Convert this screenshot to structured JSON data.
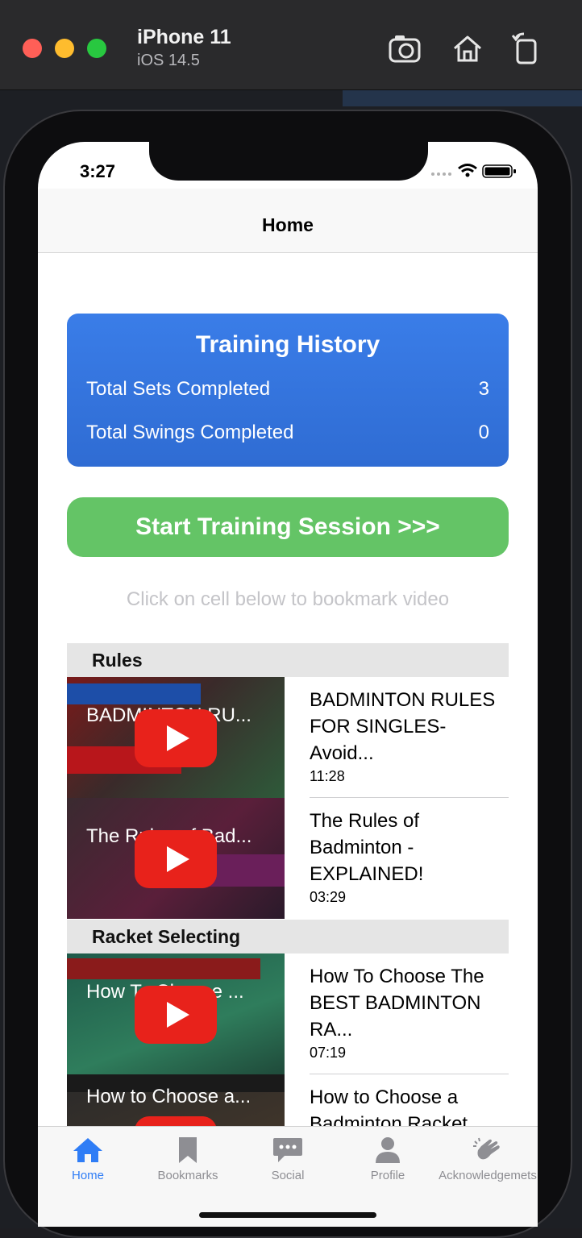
{
  "simulator": {
    "device_name": "iPhone 11",
    "os_version": "iOS 14.5"
  },
  "status_bar": {
    "time": "3:27"
  },
  "nav": {
    "title": "Home"
  },
  "training_history": {
    "title": "Training History",
    "rows": [
      {
        "label": "Total Sets Completed",
        "value": "3"
      },
      {
        "label": "Total Swings Completed",
        "value": "0"
      }
    ]
  },
  "start_button": {
    "label": "Start Training Session >>>"
  },
  "hint": "Click on cell below to bookmark video",
  "sections": [
    {
      "title": "Rules",
      "videos": [
        {
          "title": "BADMINTON RULES FOR SINGLES- Avoid...",
          "duration": "11:28",
          "thumb_text": "BADMINTON RU..."
        },
        {
          "title": "The Rules of Badminton - EXPLAINED!",
          "duration": "03:29",
          "thumb_text": "The Rules of Bad..."
        }
      ]
    },
    {
      "title": "Racket Selecting",
      "videos": [
        {
          "title": "How To Choose The BEST BADMINTON RA...",
          "duration": "07:19",
          "thumb_text": "How To Choose ..."
        },
        {
          "title": "How to Choose a Badminton Racket",
          "duration": "",
          "thumb_text": "How to Choose a..."
        }
      ]
    }
  ],
  "tab_bar": {
    "items": [
      {
        "label": "Home",
        "icon": "house-icon",
        "active": true
      },
      {
        "label": "Bookmarks",
        "icon": "bookmark-icon",
        "active": false
      },
      {
        "label": "Social",
        "icon": "chat-bubble-icon",
        "active": false
      },
      {
        "label": "Profile",
        "icon": "person-icon",
        "active": false
      },
      {
        "label": "Acknowledgemets",
        "icon": "clapping-hands-icon",
        "active": false
      }
    ]
  },
  "colors": {
    "history_card": "#3174dd",
    "start_button": "#64c466",
    "tab_active": "#2f7df6",
    "tab_inactive": "#8e8e93",
    "youtube_red": "#e8221b"
  }
}
